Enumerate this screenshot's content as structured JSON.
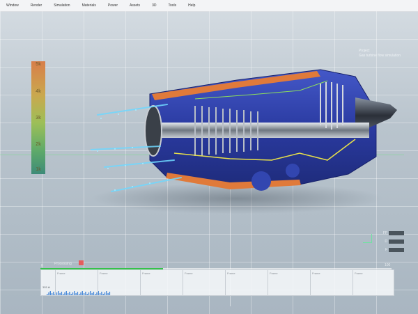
{
  "menu": [
    "Window",
    "Render",
    "Simulation",
    "Materials",
    "Power",
    "Assets",
    "3D",
    "Tools",
    "Help"
  ],
  "scale": {
    "ticks": [
      "5k",
      "4k",
      "3k",
      "2k",
      "1k"
    ]
  },
  "project": {
    "label": "Project",
    "name": "Gas turbine flow simulation"
  },
  "controls": [
    {
      "label": "FF"
    },
    {
      "label": "D"
    },
    {
      "label": "F"
    }
  ],
  "timeline": {
    "start": "0",
    "end": "100",
    "status": "Processing",
    "progress": 0.35,
    "segments": [
      "Frame",
      "Frame",
      "Frame",
      "Frame",
      "Frame",
      "Frame",
      "Frame",
      "Frame"
    ],
    "wave_label": "355 kf"
  },
  "colors": {
    "accent": "#35c24a",
    "alert": "#e45d5d"
  }
}
